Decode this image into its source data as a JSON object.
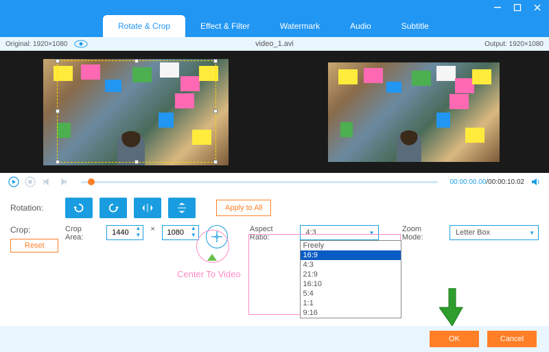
{
  "tabs": {
    "rotate_crop": "Rotate & Crop",
    "effect_filter": "Effect & Filter",
    "watermark": "Watermark",
    "audio": "Audio",
    "subtitle": "Subtitle"
  },
  "info": {
    "original_label": "Original: 1920×1080",
    "filename": "video_1.avi",
    "output_label": "Output: 1920×1080"
  },
  "playback": {
    "current": "00:00:00.00",
    "total": "/00:00:10.02"
  },
  "rotation": {
    "label": "Rotation:",
    "apply_all": "Apply to All"
  },
  "crop": {
    "label": "Crop:",
    "reset": "Reset",
    "area_label": "Crop Area:",
    "width": "1440",
    "times": "×",
    "height": "1080"
  },
  "aspect": {
    "label": "Aspect Ratio:",
    "value": "4:3",
    "options": [
      "Freely",
      "16:9",
      "4:3",
      "21:9",
      "16:10",
      "5:4",
      "1:1",
      "9:16"
    ],
    "selected": "16:9"
  },
  "zoom": {
    "label": "Zoom Mode:",
    "value": "Letter Box"
  },
  "hint": {
    "center": "Center To Video"
  },
  "footer": {
    "ok": "OK",
    "cancel": "Cancel"
  }
}
